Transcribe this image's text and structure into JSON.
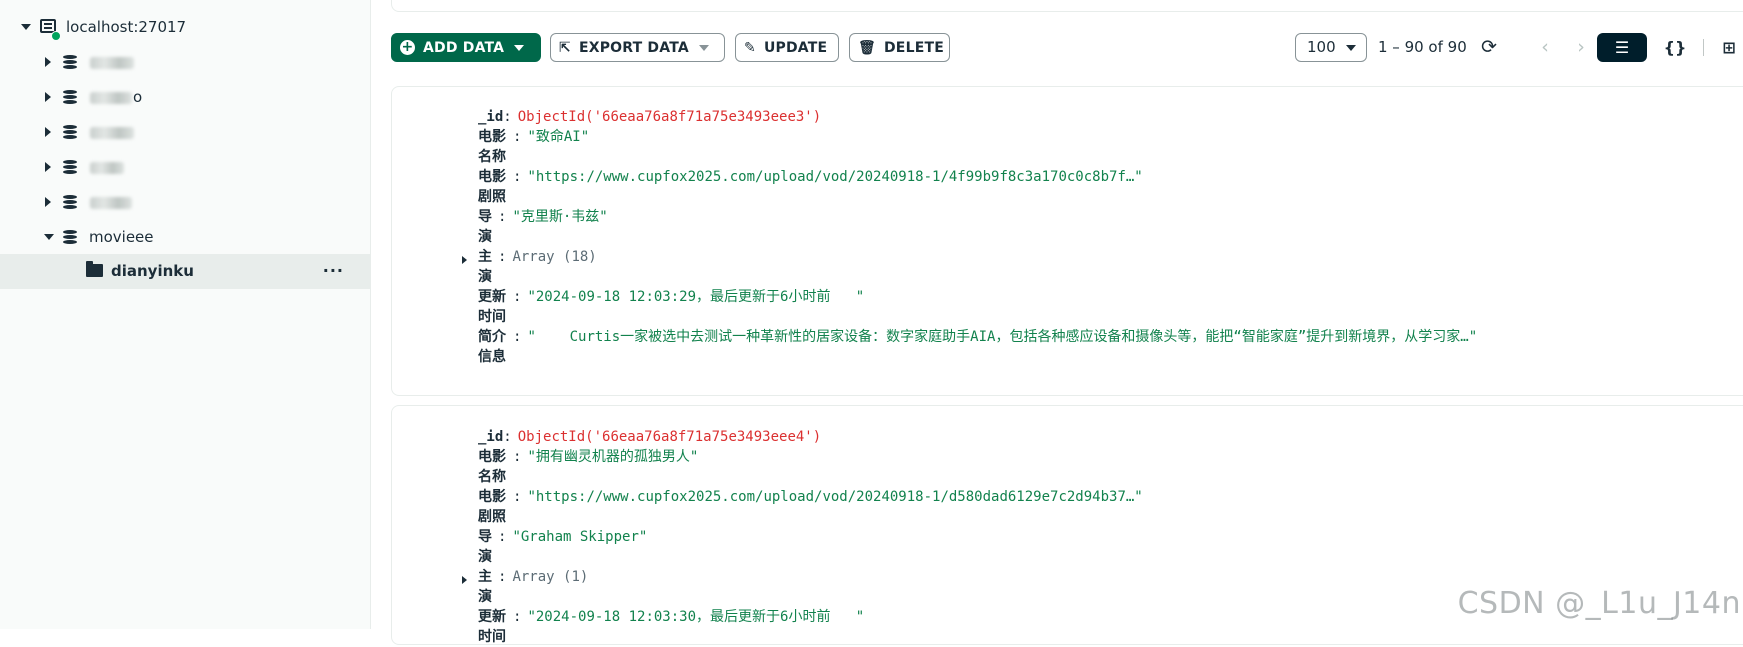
{
  "sidebar": {
    "connection": {
      "label": "localhost:27017",
      "status_color": "#00a35c"
    },
    "databases": [
      {
        "label": "",
        "redacted": true
      },
      {
        "label": "o",
        "redacted": true
      },
      {
        "label": "",
        "redacted": true
      },
      {
        "label": "",
        "redacted": true
      },
      {
        "label": "",
        "redacted": true
      },
      {
        "label": "movieee",
        "redacted": false,
        "expanded": true
      }
    ],
    "collection": {
      "label": "dianyinku",
      "menu_label": "···"
    }
  },
  "toolbar": {
    "add_data_label": "ADD DATA",
    "export_data_label": "EXPORT DATA",
    "update_label": "UPDATE",
    "delete_label": "DELETE",
    "page_size": "100",
    "pagination_text": "1 – 90 of 90"
  },
  "colors": {
    "primary": "#00684a",
    "string_value": "#12824d",
    "objectid_value": "#db3030",
    "view_active": "#001e2b"
  },
  "documents": [
    {
      "id_key": "_id",
      "id_value": "ObjectId('66eaa76a8f71a75e3493eee3')",
      "name_key": "电影名称",
      "name_value": "\"致命AI\"",
      "photo_key": "电影剧照",
      "photo_value": "\"https://www.cupfox2025.com/upload/vod/20240918-1/4f99b9f8c3a170c0c8b7f…\"",
      "director_key": "导演",
      "director_value": "\"克里斯·韦兹\"",
      "actors_key": "主演",
      "actors_value": "Array (18)",
      "updated_key": "更新时间",
      "updated_value": "\"2024-09-18 12:03:29，最后更新于6小时前   \"",
      "summary_key": "简介信息",
      "summary_value": "\"    Curtis一家被选中去测试一种革新性的居家设备：数字家庭助手AIA，包括各种感应设备和摄像头等，能把“智能家庭”提升到新境界，从学习家…\""
    },
    {
      "id_key": "_id",
      "id_value": "ObjectId('66eaa76a8f71a75e3493eee4')",
      "name_key": "电影名称",
      "name_value": "\"拥有幽灵机器的孤独男人\"",
      "photo_key": "电影剧照",
      "photo_value": "\"https://www.cupfox2025.com/upload/vod/20240918-1/d580dad6129e7c2d94b37…\"",
      "director_key": "导演",
      "director_value": "\"Graham Skipper\"",
      "actors_key": "主演",
      "actors_value": "Array (1)",
      "updated_key": "更新时间",
      "updated_value": "\"2024-09-18 12:03:30，最后更新于6小时前   \""
    }
  ],
  "watermark": "CSDN @_L1u_J14n"
}
